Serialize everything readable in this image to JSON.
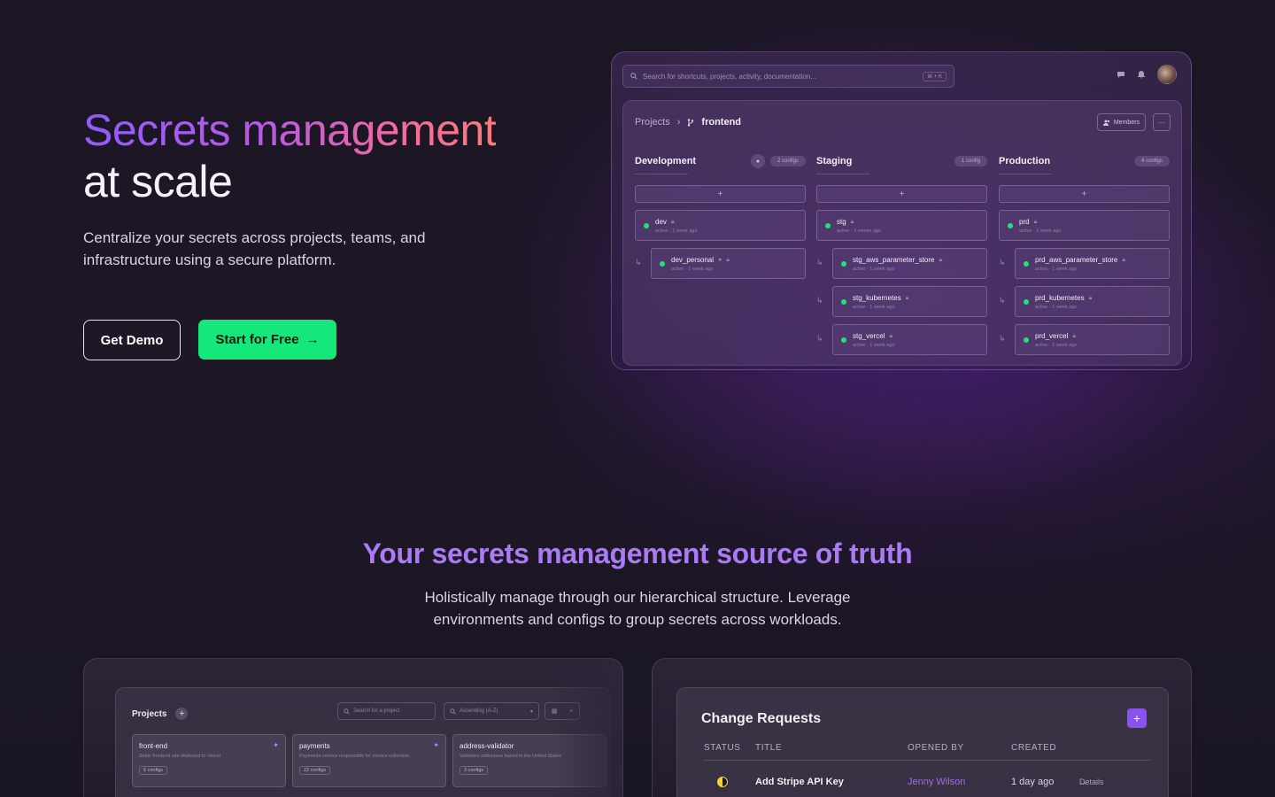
{
  "hero": {
    "title_line1": "Secrets management",
    "title_line2": "at scale",
    "subtitle": "Centralize your secrets across projects, teams, and infrastructure using a secure platform.",
    "btn_demo": "Get Demo",
    "btn_start": "Start for Free",
    "btn_start_icon": "→"
  },
  "app": {
    "search_placeholder": "Search for shortcuts, projects, activity, documentation...",
    "search_kbd": "⌘ + K",
    "icons": {
      "chat": "chat-icon",
      "bell": "bell-icon"
    },
    "breadcrumb_root": "Projects",
    "breadcrumb_sep": "›",
    "breadcrumb_current": "frontend",
    "members_label": "Members",
    "more_label": "···",
    "add_symbol": "+",
    "branch_symbol": "↳",
    "environments": [
      {
        "name": "Development",
        "count": "2 configs",
        "root": {
          "name": "dev",
          "status": "active · 1 week ago"
        },
        "branches": [
          {
            "name": "dev_personal",
            "status": "active · 1 week ago"
          }
        ]
      },
      {
        "name": "Staging",
        "count": "1 config",
        "root": {
          "name": "stg",
          "status": "active · 2 weeks ago"
        },
        "branches": [
          {
            "name": "stg_aws_parameter_store",
            "status": "active · 1 week ago"
          },
          {
            "name": "stg_kubernetes",
            "status": "active · 1 week ago"
          },
          {
            "name": "stg_vercel",
            "status": "active · 1 week ago"
          }
        ]
      },
      {
        "name": "Production",
        "count": "4 configs",
        "root": {
          "name": "prd",
          "status": "active · 1 week ago"
        },
        "branches": [
          {
            "name": "prd_aws_parameter_store",
            "status": "active · 1 week ago"
          },
          {
            "name": "prd_kubernetes",
            "status": "active · 1 week ago"
          },
          {
            "name": "prd_vercel",
            "status": "active · 1 week ago"
          }
        ]
      }
    ]
  },
  "section2": {
    "title": "Your secrets management source of truth",
    "subtitle_line1": "Holistically manage through our hierarchical structure. Leverage",
    "subtitle_line2": "environments and configs to group secrets across workloads."
  },
  "projects": {
    "title": "Projects",
    "add": "+",
    "search_placeholder": "Search for a project",
    "sort_label": "Ascending (A-Z)",
    "more": "···",
    "cards": [
      {
        "name": "front-end",
        "desc": "Static frontend site deployed to Vercel",
        "configs": "5 configs"
      },
      {
        "name": "payments",
        "desc": "Payments service responsible for invoice collection.",
        "configs": "22 configs"
      },
      {
        "name": "address-validator",
        "desc": "Validates addresses based in the United States",
        "configs": "3 configs"
      }
    ]
  },
  "change_requests": {
    "title": "Change Requests",
    "add": "+",
    "columns": [
      "STATUS",
      "TITLE",
      "OPENED BY",
      "CREATED"
    ],
    "rows": [
      {
        "title": "Add Stripe API Key",
        "opened_by": "Jenny Wilson",
        "created": "1 day ago",
        "details": "Details"
      }
    ]
  }
}
